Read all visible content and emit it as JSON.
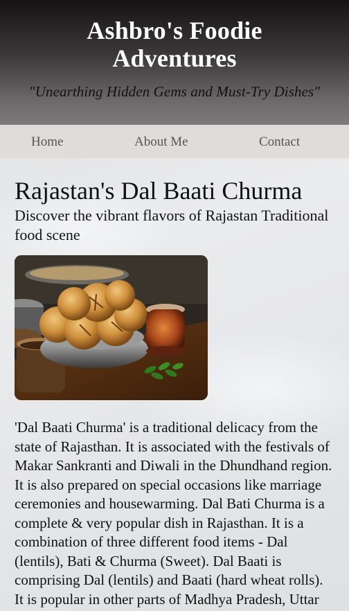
{
  "header": {
    "title": "Ashbro's Foodie Adventures",
    "tagline": "\"Unearthing Hidden Gems and Must-Try Dishes\""
  },
  "nav": {
    "items": [
      {
        "label": "Home"
      },
      {
        "label": "About Me"
      },
      {
        "label": "Contact"
      }
    ]
  },
  "article": {
    "title": "Rajastan's Dal Baati Churma",
    "subtitle": "Discover the vibrant flavors of Rajastan Traditional food scene",
    "image_alt": "Dal Baati Churma",
    "body": "'Dal Baati Churma' is a traditional delicacy from the state of Rajasthan. It is associated with the festivals of Makar Sankranti and Diwali in the Dhundhand region. It is also prepared on special occasions like marriage ceremonies and housewarming. Dal Bati Churma is a complete & very popular dish in Rajasthan. It is a combination of three different food items - Dal (lentils), Bati & Churma (Sweet). Dal Baati is comprising Dal (lentils) and Baati (hard wheat rolls). It is popular in other parts of Madhya Pradesh, Uttar Pradesh and Delhi."
  },
  "colors": {
    "header_top": "#161314",
    "header_bottom": "#7d7a7b",
    "nav_bg": "#e0dcda",
    "nav_text": "#555555",
    "page_bg": "#e9eaec"
  }
}
